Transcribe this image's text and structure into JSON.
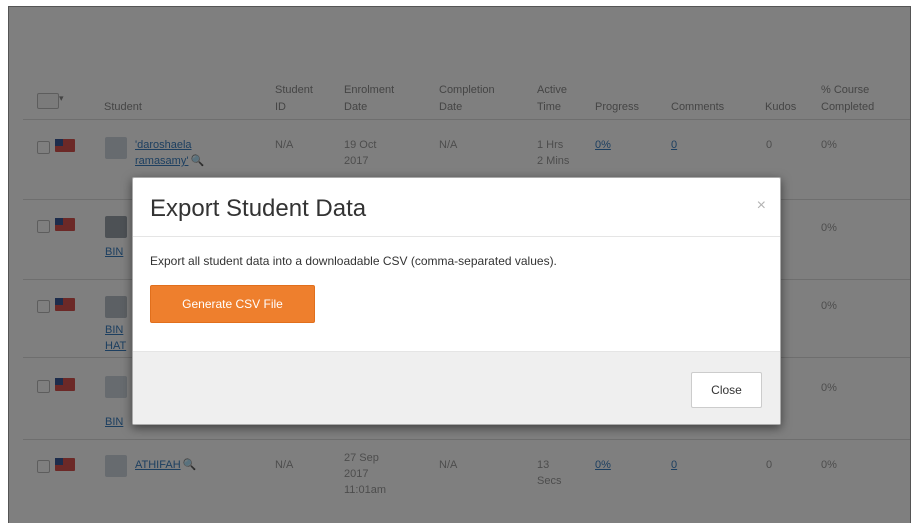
{
  "table": {
    "headers": {
      "student": "Student",
      "student_id_1": "Student",
      "student_id_2": "ID",
      "enrolment_1": "Enrolment",
      "enrolment_2": "Date",
      "completion_1": "Completion",
      "completion_2": "Date",
      "active_1": "Active",
      "active_2": "Time",
      "progress": "Progress",
      "comments": "Comments",
      "kudos": "Kudos",
      "course_1": "% Course",
      "course_2": "Completed"
    },
    "rows": [
      {
        "name_1": "'daroshaela",
        "name_2": "ramasamy'",
        "student_id": "N/A",
        "enrol_1": "19 Oct",
        "enrol_2": "2017",
        "completion": "N/A",
        "active_1": "1 Hrs",
        "active_2": "2 Mins",
        "progress": "0%",
        "comments": "0",
        "kudos": "0",
        "course": "0%"
      },
      {
        "name_1": "BIN",
        "course": "0%"
      },
      {
        "name_1": "BIN",
        "name_2": "HAT",
        "course": "0%"
      },
      {
        "name_1": "BIN",
        "course": "0%"
      },
      {
        "name_1": "ATHIFAH",
        "student_id": "N/A",
        "enrol_1": "27 Sep",
        "enrol_2": "2017",
        "enrol_3": "11:01am",
        "completion": "N/A",
        "active_1": "13",
        "active_2": "Secs",
        "progress": "0%",
        "comments": "0",
        "kudos": "0",
        "course": "0%"
      }
    ]
  },
  "modal": {
    "title": "Export Student Data",
    "close_icon": "×",
    "description": "Export all student data into a downloadable CSV (comma-separated values).",
    "generate_button": "Generate CSV File",
    "close_button": "Close"
  },
  "colors": {
    "primary_button": "#ee7f2d",
    "link": "#2a6db2",
    "backdrop": "rgba(0,0,0,0.5)"
  }
}
